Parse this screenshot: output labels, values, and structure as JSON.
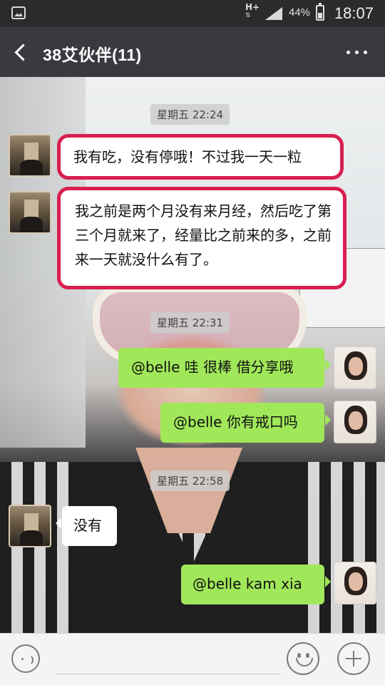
{
  "status_bar": {
    "network": "H+",
    "battery": "44%",
    "time": "18:07"
  },
  "header": {
    "title": "38艾伙伴(11)"
  },
  "messages": [
    {
      "type": "timestamp",
      "text": "星期五 22:24"
    },
    {
      "type": "received",
      "text": "我有吃，没有停哦！不过我一天一粒",
      "highlighted": true
    },
    {
      "type": "received",
      "text": "我之前是两个月没有来月经，然后吃了第三个月就来了，经量比之前来的多，之前来一天就没什么有了。",
      "highlighted": true
    },
    {
      "type": "timestamp",
      "text": "星期五 22:31"
    },
    {
      "type": "sent",
      "text": "@belle  哇 很棒 借分享哦"
    },
    {
      "type": "sent",
      "text": "@belle  你有戒口吗"
    },
    {
      "type": "timestamp",
      "text": "星期五 22:58"
    },
    {
      "type": "received",
      "text": "没有"
    },
    {
      "type": "sent",
      "text": "@belle kam xia"
    }
  ],
  "colors": {
    "highlight_border": "#d81f4f",
    "sent_bubble": "#a0e75a",
    "header_bg": "#393a3f"
  }
}
